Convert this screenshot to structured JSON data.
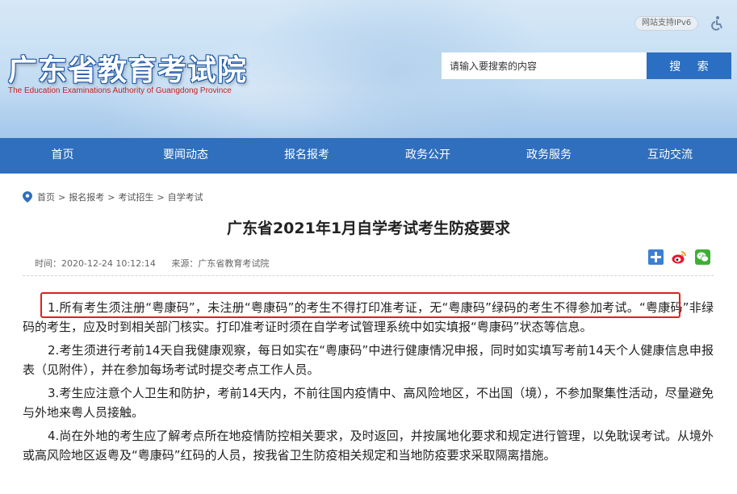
{
  "header": {
    "logo_cn": "广东省教育考试院",
    "logo_en": "The Education Examinations Authority of Guangdong Province",
    "ipv6_badge": "网站支持IPv6",
    "search_placeholder": "请输入要搜索的内容",
    "search_button": "搜 索"
  },
  "nav": {
    "items": [
      "首页",
      "要闻动态",
      "报名报考",
      "政务公开",
      "政务服务",
      "互动交流"
    ]
  },
  "breadcrumb": {
    "items": [
      "首页",
      "报名报考",
      "考试招生",
      "自学考试"
    ],
    "separator": ">"
  },
  "article": {
    "title": "广东省2021年1月自学考试考生防疫要求",
    "time": "时间：2020-12-24 10:12:14",
    "source": "来源：广东省教育考试院",
    "paragraphs": [
      "1.所有考生须注册“粤康码”，未注册“粤康码”的考生不得打印准考证，无“粤康码”绿码的考生不得参加考试。“粤康码”非绿码的考生，应及时到相关部门核实。打印准考证时须在自学考试管理系统中如实填报“粤康码”状态等信息。",
      "2.考生须进行考前14天自我健康观察，每日如实在“粤康码”中进行健康情况申报，同时如实填写考前14天个人健康信息申报表（见附件），并在参加每场考试时提交考点工作人员。",
      "3.考生应注意个人卫生和防护，考前14天内，不前往国内疫情中、高风险地区，不出国（境），不参加聚集性活动，尽量避免与外地来粤人员接触。",
      "4.尚在外地的考生应了解考点所在地疫情防控相关要求，及时返回，并按属地化要求和规定进行管理，以免耽误考试。从境外或高风险地区返粤及“粤康码”红码的人员，按我省卫生防疫相关规定和当地防疫要求采取隔离措施。"
    ]
  },
  "icons": {
    "breadcrumb": "map-pin-icon",
    "share": [
      "share-plus-icon",
      "weibo-icon",
      "wechat-icon"
    ],
    "accessibility": "accessibility-icon"
  },
  "colors": {
    "nav_bg": "#2f6fbd",
    "search_button": "#2a6fc1",
    "highlight": "#e02020"
  }
}
